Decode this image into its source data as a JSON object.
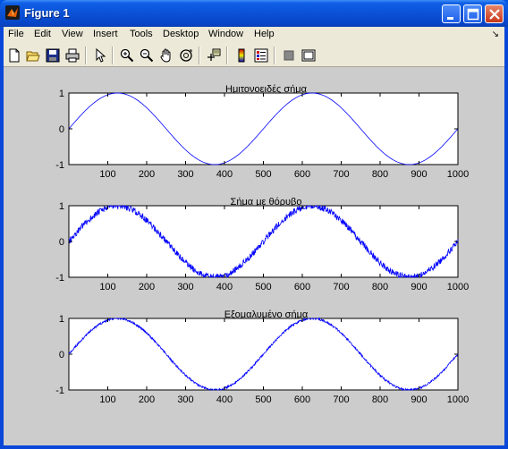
{
  "window": {
    "title": "Figure 1"
  },
  "menu": {
    "items": [
      {
        "label": "File"
      },
      {
        "label": "Edit"
      },
      {
        "label": "View"
      },
      {
        "label": "Insert"
      },
      {
        "label": "Tools"
      },
      {
        "label": "Desktop"
      },
      {
        "label": "Window"
      },
      {
        "label": "Help"
      }
    ]
  },
  "toolbar": {
    "tools": [
      "new-figure-icon",
      "open-file-icon",
      "save-icon",
      "print-icon",
      "edit-plot-pointer-icon",
      "zoom-in-icon",
      "zoom-out-icon",
      "pan-hand-icon",
      "rotate-3d-icon",
      "data-cursor-icon",
      "colorbar-icon",
      "legend-icon",
      "hide-plot-tools-icon",
      "show-plot-tools-icon"
    ]
  },
  "colors": {
    "line": "#0000ff",
    "figure_bg": "#cccccc",
    "axes_bg": "#ffffff"
  },
  "chart_data": [
    {
      "type": "line",
      "title": "Ημιτονοειδές σήμα",
      "xlim": [
        0,
        1000
      ],
      "ylim": [
        -1,
        1
      ],
      "xticks": [
        100,
        200,
        300,
        400,
        500,
        600,
        700,
        800,
        900,
        1000
      ],
      "yticks": [
        1,
        0,
        -1
      ],
      "series": [
        {
          "period": 500,
          "amplitude": 1,
          "noise": 0
        }
      ]
    },
    {
      "type": "line",
      "title": "Σήμα με θόρυβο",
      "xlim": [
        0,
        1000
      ],
      "ylim": [
        -1,
        1
      ],
      "xticks": [
        100,
        200,
        300,
        400,
        500,
        600,
        700,
        800,
        900,
        1000
      ],
      "yticks": [
        1,
        0,
        -1
      ],
      "series": [
        {
          "period": 500,
          "amplitude": 1,
          "noise": 0.09
        }
      ]
    },
    {
      "type": "line",
      "title": "Εξομαλυμένο σήμα",
      "xlim": [
        0,
        1000
      ],
      "ylim": [
        -1,
        1
      ],
      "xticks": [
        100,
        200,
        300,
        400,
        500,
        600,
        700,
        800,
        900,
        1000
      ],
      "yticks": [
        1,
        0,
        -1
      ],
      "series": [
        {
          "period": 500,
          "amplitude": 1,
          "noise": 0.03
        }
      ]
    }
  ]
}
